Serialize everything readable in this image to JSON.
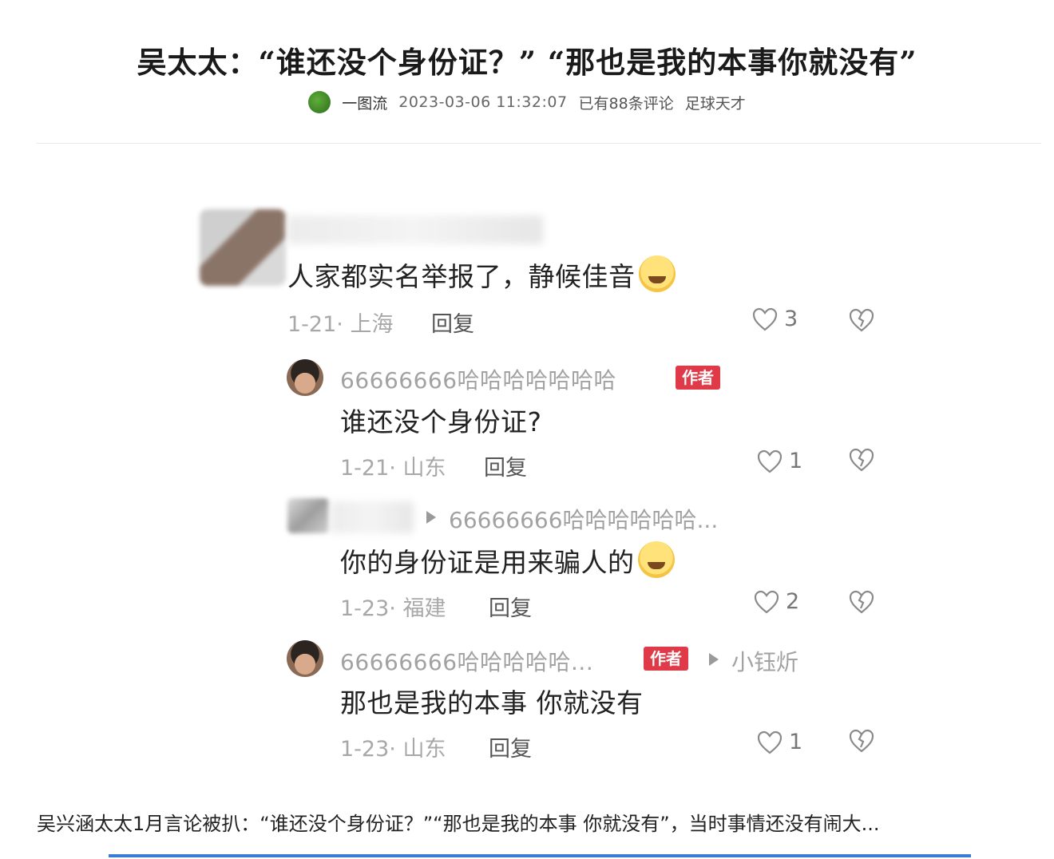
{
  "article": {
    "title": "吴太太：“谁还没个身份证？” “那也是我的本事你就没有”",
    "author": "一图流",
    "datetime": "2023-03-06 11:32:07",
    "comment_count": "已有88条评论",
    "channel": "足球天才"
  },
  "comments": [
    {
      "content": "人家都实名举报了，静候佳音",
      "date_loc": "1-21· 上海",
      "reply_label": "回复",
      "likes": "3"
    },
    {
      "username": "66666666哈哈哈哈哈哈哈",
      "badge": "作者",
      "content": "谁还没个身份证?",
      "date_loc": "1-21· 山东",
      "reply_label": "回复",
      "likes": "1"
    },
    {
      "reply_to": "66666666哈哈哈哈哈哈...",
      "content": "你的身份证是用来骗人的",
      "date_loc": "1-23· 福建",
      "reply_label": "回复",
      "likes": "2"
    },
    {
      "username": "66666666哈哈哈哈哈...",
      "badge": "作者",
      "reply_to": "小钰炘",
      "content": "那也是我的本事 你就没有",
      "date_loc": "1-23· 山东",
      "reply_label": "回复",
      "likes": "1"
    }
  ],
  "caption": "吴兴涵太太1月言论被扒：“谁还没个身份证？”“那也是我的本事 你就没有”，当时事情还没有闹大...",
  "colors": {
    "badge": "#e03a48",
    "accent_bar": "#3a7bd5"
  },
  "icons": [
    "heart-icon",
    "dislike-icon",
    "reply-arrow-icon",
    "emoji-icon"
  ]
}
